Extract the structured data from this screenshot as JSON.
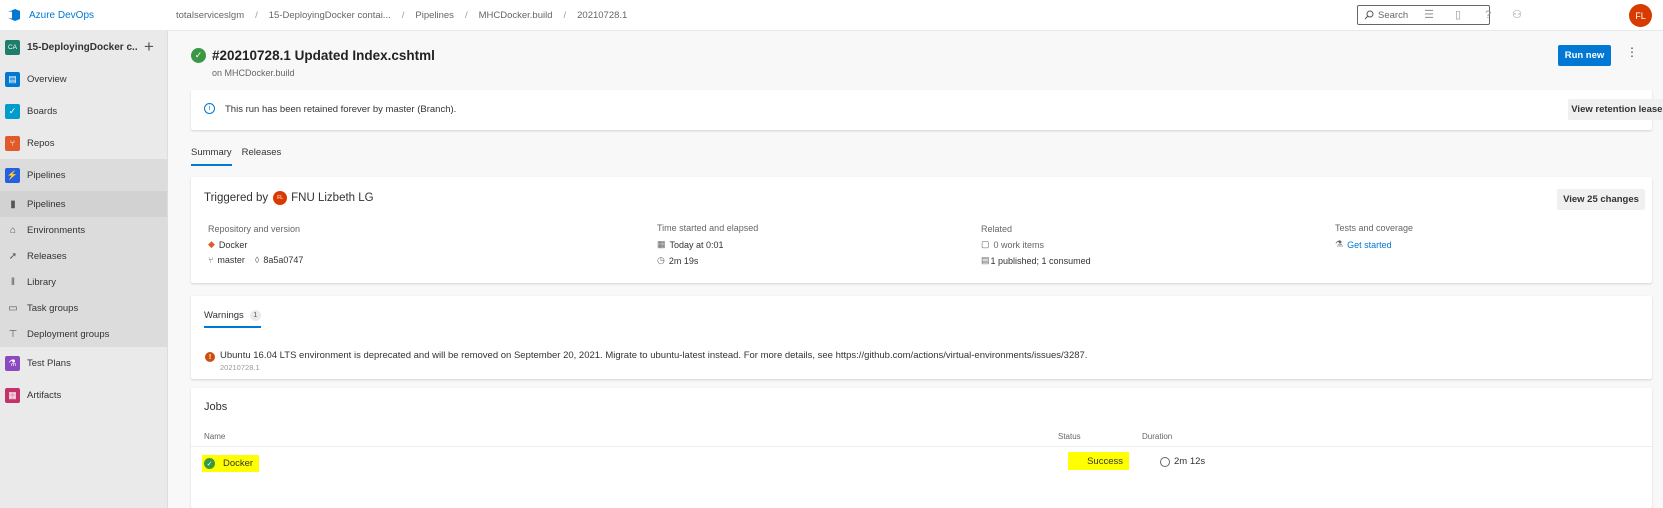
{
  "header": {
    "brand": "Azure DevOps",
    "breadcrumbs": [
      "totalserviceslgm",
      "15-DeployingDocker contai...",
      "Pipelines",
      "MHCDocker.build",
      "20210728.1"
    ],
    "search_placeholder": "Search",
    "user_initials": "FL",
    "icons": [
      "list-icon",
      "shopping-bag-icon",
      "help-icon",
      "user-settings-icon"
    ]
  },
  "sidebar": {
    "project_initials": "CA",
    "project_name": "15-DeployingDocker c...",
    "items": [
      {
        "label": "Overview",
        "icon": "overview-icon",
        "color": "#0078d4"
      },
      {
        "label": "Boards",
        "icon": "boards-icon",
        "color": "#009ccc"
      },
      {
        "label": "Repos",
        "icon": "repos-icon",
        "color": "#e05b29"
      },
      {
        "label": "Pipelines",
        "icon": "pipelines-icon",
        "color": "#2560e0"
      }
    ],
    "sub_items": [
      {
        "label": "Pipelines",
        "icon": "bar-chart-icon"
      },
      {
        "label": "Environments",
        "icon": "environment-icon"
      },
      {
        "label": "Releases",
        "icon": "rocket-icon"
      },
      {
        "label": "Library",
        "icon": "library-icon"
      },
      {
        "label": "Task groups",
        "icon": "task-groups-icon"
      },
      {
        "label": "Deployment groups",
        "icon": "deployment-groups-icon"
      }
    ],
    "bottom_items": [
      {
        "label": "Test Plans",
        "icon": "test-plans-icon",
        "color": "#8b4bbf"
      },
      {
        "label": "Artifacts",
        "icon": "artifacts-icon",
        "color": "#c4326c"
      }
    ]
  },
  "run": {
    "title": "#20210728.1 Updated Index.cshtml",
    "subtitle": "on MHCDocker.build",
    "run_new": "Run new",
    "more": "⋮"
  },
  "retention": {
    "message": "This run has been retained forever by master (Branch).",
    "button": "View retention leases"
  },
  "tabs": [
    "Summary",
    "Releases"
  ],
  "summary": {
    "triggered_by_label": "Triggered by",
    "triggered_by_initials": "FL",
    "triggered_by_name": "FNU Lizbeth LG",
    "changes_button": "View 25 changes",
    "repository_heading": "Repository and version",
    "repository": "Docker",
    "branch": "master",
    "commit": "8a5a0747",
    "time_heading": "Time started and elapsed",
    "started": "Today at 0:01",
    "elapsed": "2m 19s",
    "related_heading": "Related",
    "work_items": "0 work items",
    "artifacts": "1 published; 1 consumed",
    "tests_heading": "Tests and coverage",
    "tests_link": "Get started"
  },
  "warnings": {
    "tab_label": "Warnings",
    "count": "1",
    "message": "Ubuntu 16.04 LTS environment is deprecated and will be removed on September 20, 2021. Migrate to ubuntu-latest instead. For more details, see https://github.com/actions/virtual-environments/issues/3287.",
    "source": "20210728.1"
  },
  "jobs": {
    "title": "Jobs",
    "columns": {
      "name": "Name",
      "status": "Status",
      "duration": "Duration"
    },
    "rows": [
      {
        "name": "Docker",
        "status": "Success",
        "duration": "2m 12s"
      }
    ],
    "highlight_color": "#ffff00",
    "success_color": "#3a9845"
  }
}
